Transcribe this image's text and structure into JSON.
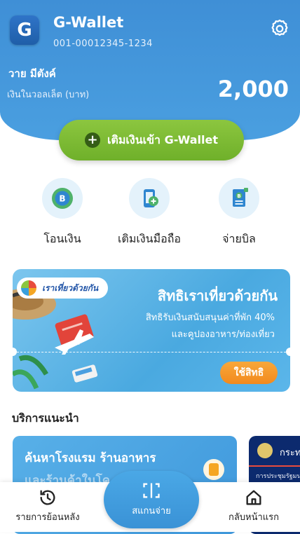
{
  "header": {
    "logo_letter": "G",
    "app_title": "G-Wallet",
    "account_number": "001-00012345-1234",
    "user_name": "วาย มีตังค์",
    "balance_label": "เงินในวอลเล็ต (บาท)",
    "balance": "2,000",
    "settings_icon": "gear-icon"
  },
  "topup_button": {
    "label": "เติมเงินเข้า G-Wallet",
    "icon": "plus-circle-icon"
  },
  "quick_actions": [
    {
      "label": "โอนเงิน",
      "icon": "transfer-coin-icon"
    },
    {
      "label": "เติมเงินมือถือ",
      "icon": "mobile-topup-icon"
    },
    {
      "label": "จ่ายบิล",
      "icon": "bill-icon"
    }
  ],
  "promo_banner": {
    "tag": "เราเที่ยวด้วยกัน",
    "title": "สิทธิเราเที่ยวด้วยกัน",
    "subtitle_line1": "สิทธิรับเงินสนับสนุนค่าที่พัก 40%",
    "subtitle_line2": "และคูปองอาหาร/ท่องเที่ยว",
    "button": "ใช้สิทธิ"
  },
  "recommended": {
    "title": "บริการแนะนำ",
    "cards": [
      {
        "line1": "ค้นหาโรงแรม ร้านอาหาร",
        "line2": "และร้านค้าในโค"
      },
      {
        "title": "กระท",
        "subtitle": "การประชุมรัฐมน"
      }
    ]
  },
  "bottom_nav": {
    "history": {
      "label": "รายการย้อนหลัง",
      "icon": "history-icon"
    },
    "scan": {
      "label": "สแกนจ่าย",
      "icon": "scan-icon"
    },
    "home": {
      "label": "กลับหน้าแรก",
      "icon": "home-icon"
    }
  },
  "colors": {
    "header_blue": "#4a9fe0",
    "topup_green": "#7dbb34",
    "promo_orange": "#f5962a",
    "icon_blue": "#2f86d0",
    "icon_green": "#4fb26a"
  }
}
